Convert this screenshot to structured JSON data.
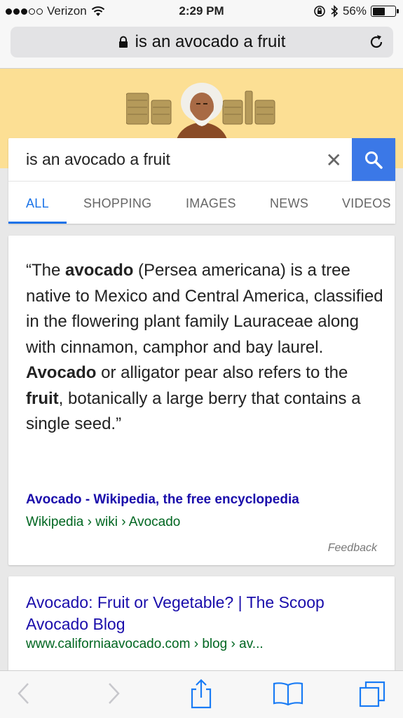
{
  "status_bar": {
    "carrier": "Verizon",
    "time": "2:29 PM",
    "battery": "56%",
    "battery_level": 0.56
  },
  "url_bar": {
    "text": "is an avocado a fruit"
  },
  "search": {
    "query": "is an avocado a fruit"
  },
  "tabs": [
    "ALL",
    "SHOPPING",
    "IMAGES",
    "NEWS",
    "VIDEOS"
  ],
  "featured_snippet": {
    "quote_open": "“The ",
    "b1": "avocado",
    "t1": " (Persea americana) is a tree native to Mexico and Central America, classified in the flowering plant family Lauraceae along with cinnamon, camphor and bay laurel. ",
    "b2": "Avocado",
    "t2": " or alligator pear also refers to the ",
    "b3": "fruit",
    "t3": ", botanically a large berry that contains a single seed.”",
    "source_title": "Avocado - Wikipedia, the free encyclopedia",
    "source_url": "Wikipedia › wiki › Avocado",
    "feedback": "Feedback"
  },
  "result2": {
    "title": "Avocado: Fruit or Vegetable? | The Scoop Avocado Blog",
    "url": "www.californiaavocado.com › blog › av..."
  },
  "colors": {
    "accent_blue": "#3b78e7",
    "link": "#1a0dab",
    "url_green": "#006621",
    "doodle_bg": "#fcdf94"
  }
}
